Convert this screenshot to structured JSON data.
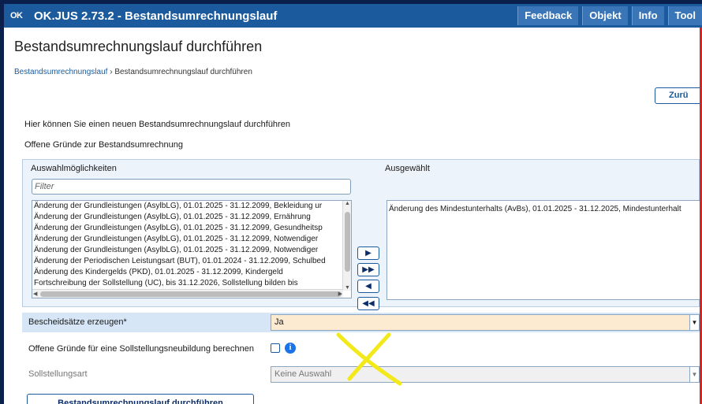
{
  "window": {
    "logo": "OK",
    "title": "OK.JUS 2.73.2 - Bestandsumrechnungslauf",
    "buttons": [
      "Feedback",
      "Objekt",
      "Info",
      "Tool"
    ]
  },
  "page": {
    "title": "Bestandsumrechnungslauf durchführen",
    "breadcrumb": {
      "link": "Bestandsumrechnungslauf",
      "separator": "›",
      "current": "Bestandsumrechnungslauf durchführen"
    },
    "back_button": "Zurü",
    "intro_text": "Hier können Sie einen neuen Bestandsumrechnungslauf durchführen",
    "section_label": "Offene Gründe zur Bestandsumrechnung"
  },
  "picker": {
    "available_label": "Auswahlmöglichkeiten",
    "selected_label": "Ausgewählt",
    "filter_placeholder": "Filter",
    "available_items": [
      "Änderung der Grundleistungen (AsylbLG), 01.01.2025 - 31.12.2099, Bekleidung ur",
      "Änderung der Grundleistungen (AsylbLG), 01.01.2025 - 31.12.2099, Ernährung",
      "Änderung der Grundleistungen (AsylbLG), 01.01.2025 - 31.12.2099, Gesundheitsp",
      "Änderung der Grundleistungen (AsylbLG), 01.01.2025 - 31.12.2099, Notwendiger",
      "Änderung der Grundleistungen (AsylbLG), 01.01.2025 - 31.12.2099, Notwendiger",
      "Änderung der Periodischen Leistungsart (BUT), 01.01.2024 - 31.12.2099, Schulbed",
      "Änderung des Kindergelds (PKD), 01.01.2025 - 31.12.2099, Kindergeld",
      "Fortschreibung der Sollstellung (UC), bis 31.12.2026, Sollstellung bilden bis"
    ],
    "selected_items": [
      "Änderung des Mindestunterhalts (AvBs), 01.01.2025 - 31.12.2025, Mindestunterhalt"
    ],
    "move_buttons": {
      "move_right": "▶",
      "move_all_right": "▶▶",
      "move_left": "◀",
      "move_all_left": "◀◀"
    },
    "scroll_arrows": {
      "up": "▲",
      "down": "▼",
      "left": "◀",
      "right": "▶"
    }
  },
  "form": {
    "bescheid_label": "Bescheidsätze erzeugen*",
    "bescheid_value": "Ja",
    "offene_label": "Offene Gründe für eine Sollstellungsneubildung berechnen",
    "info_glyph": "i",
    "sollstellungsart_label": "Sollstellungsart",
    "sollstellungsart_value": "Keine Auswahl",
    "chevron_glyph": "▼"
  },
  "actions": {
    "run_button": "Bestandsumrechnungslauf durchführen"
  },
  "colors": {
    "titlebar": "#1b5a9c",
    "outer_background": "#0b1f4d",
    "highlight_row": "#d7e6f6",
    "active_select": "#fcebd0",
    "annotation_mark": "#f2e81a",
    "right_edge": "#d12727"
  }
}
